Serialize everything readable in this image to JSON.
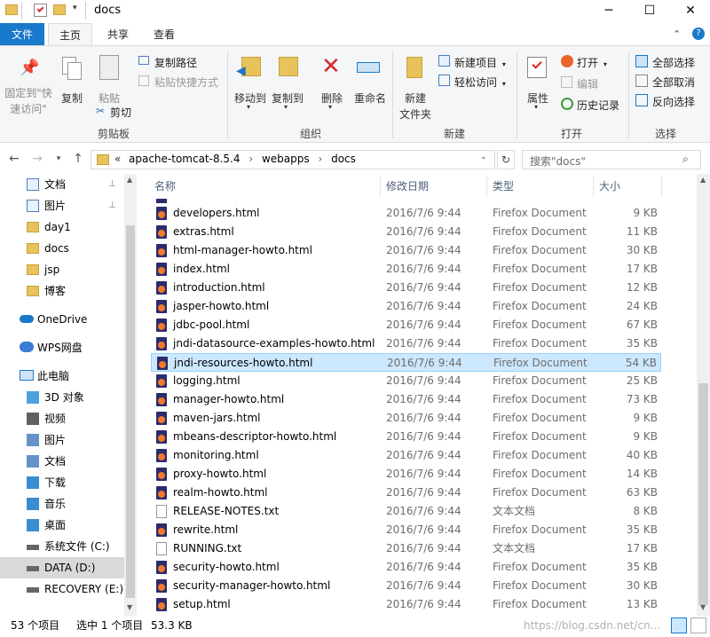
{
  "window": {
    "title": "docs"
  },
  "ribbon_tabs": [
    "文件",
    "主页",
    "共享",
    "查看"
  ],
  "ribbon": {
    "clipboard": {
      "pin_quick_access_line1": "固定到\"快",
      "pin_quick_access_line2": "速访问\"",
      "copy": "复制",
      "paste": "粘贴",
      "copy_path": "复制路径",
      "paste_shortcut": "粘贴快捷方式",
      "cut": "剪切",
      "group": "剪贴板"
    },
    "organize": {
      "move_to": "移动到",
      "copy_to": "复制到",
      "delete": "删除",
      "rename": "重命名",
      "group": "组织"
    },
    "new": {
      "new_folder_line1": "新建",
      "new_folder_line2": "文件夹",
      "new_item": "新建项目",
      "easy_access": "轻松访问",
      "group": "新建"
    },
    "open": {
      "properties": "属性",
      "open": "打开",
      "edit": "编辑",
      "history": "历史记录",
      "group": "打开"
    },
    "select": {
      "select_all": "全部选择",
      "select_none": "全部取消",
      "invert": "反向选择",
      "group": "选择"
    }
  },
  "address": {
    "breadcrumb": [
      "apache-tomcat-8.5.4",
      "webapps",
      "docs"
    ],
    "overflow": "«",
    "search_placeholder": "搜索\"docs\""
  },
  "nav": {
    "quick_access": [
      {
        "label": "文档",
        "icon": "documents-icon",
        "pinned": true
      },
      {
        "label": "图片",
        "icon": "pictures-icon",
        "pinned": true
      },
      {
        "label": "day1",
        "icon": "folder-icon",
        "pinned": false
      },
      {
        "label": "docs",
        "icon": "folder-icon",
        "pinned": false
      },
      {
        "label": "jsp",
        "icon": "folder-icon",
        "pinned": false
      },
      {
        "label": "博客",
        "icon": "folder-icon",
        "pinned": false
      }
    ],
    "onedrive": "OneDrive",
    "wps": "WPS网盘",
    "this_pc": "此电脑",
    "pc_items": [
      {
        "label": "3D 对象",
        "icon": "3d-objects-icon"
      },
      {
        "label": "视频",
        "icon": "videos-icon"
      },
      {
        "label": "图片",
        "icon": "pictures-icon"
      },
      {
        "label": "文档",
        "icon": "documents-icon"
      },
      {
        "label": "下载",
        "icon": "downloads-icon"
      },
      {
        "label": "音乐",
        "icon": "music-icon"
      },
      {
        "label": "桌面",
        "icon": "desktop-icon"
      },
      {
        "label": "系统文件 (C:)",
        "icon": "drive-c-icon"
      },
      {
        "label": "DATA (D:)",
        "icon": "drive-icon"
      },
      {
        "label": "RECOVERY (E:)",
        "icon": "drive-icon"
      }
    ]
  },
  "columns": {
    "name": "名称",
    "date": "修改日期",
    "type": "类型",
    "size": "大小"
  },
  "files": [
    {
      "name": "developers.html",
      "date": "2016/7/6 9:44",
      "type": "Firefox Document",
      "size": "9 KB",
      "kind": "html"
    },
    {
      "name": "extras.html",
      "date": "2016/7/6 9:44",
      "type": "Firefox Document",
      "size": "11 KB",
      "kind": "html"
    },
    {
      "name": "html-manager-howto.html",
      "date": "2016/7/6 9:44",
      "type": "Firefox Document",
      "size": "30 KB",
      "kind": "html"
    },
    {
      "name": "index.html",
      "date": "2016/7/6 9:44",
      "type": "Firefox Document",
      "size": "17 KB",
      "kind": "html"
    },
    {
      "name": "introduction.html",
      "date": "2016/7/6 9:44",
      "type": "Firefox Document",
      "size": "12 KB",
      "kind": "html"
    },
    {
      "name": "jasper-howto.html",
      "date": "2016/7/6 9:44",
      "type": "Firefox Document",
      "size": "24 KB",
      "kind": "html"
    },
    {
      "name": "jdbc-pool.html",
      "date": "2016/7/6 9:44",
      "type": "Firefox Document",
      "size": "67 KB",
      "kind": "html"
    },
    {
      "name": "jndi-datasource-examples-howto.html",
      "date": "2016/7/6 9:44",
      "type": "Firefox Document",
      "size": "35 KB",
      "kind": "html"
    },
    {
      "name": "jndi-resources-howto.html",
      "date": "2016/7/6 9:44",
      "type": "Firefox Document",
      "size": "54 KB",
      "kind": "html",
      "selected": true
    },
    {
      "name": "logging.html",
      "date": "2016/7/6 9:44",
      "type": "Firefox Document",
      "size": "25 KB",
      "kind": "html"
    },
    {
      "name": "manager-howto.html",
      "date": "2016/7/6 9:44",
      "type": "Firefox Document",
      "size": "73 KB",
      "kind": "html"
    },
    {
      "name": "maven-jars.html",
      "date": "2016/7/6 9:44",
      "type": "Firefox Document",
      "size": "9 KB",
      "kind": "html"
    },
    {
      "name": "mbeans-descriptor-howto.html",
      "date": "2016/7/6 9:44",
      "type": "Firefox Document",
      "size": "9 KB",
      "kind": "html"
    },
    {
      "name": "monitoring.html",
      "date": "2016/7/6 9:44",
      "type": "Firefox Document",
      "size": "40 KB",
      "kind": "html"
    },
    {
      "name": "proxy-howto.html",
      "date": "2016/7/6 9:44",
      "type": "Firefox Document",
      "size": "14 KB",
      "kind": "html"
    },
    {
      "name": "realm-howto.html",
      "date": "2016/7/6 9:44",
      "type": "Firefox Document",
      "size": "63 KB",
      "kind": "html"
    },
    {
      "name": "RELEASE-NOTES.txt",
      "date": "2016/7/6 9:44",
      "type": "文本文档",
      "size": "8 KB",
      "kind": "txt"
    },
    {
      "name": "rewrite.html",
      "date": "2016/7/6 9:44",
      "type": "Firefox Document",
      "size": "35 KB",
      "kind": "html"
    },
    {
      "name": "RUNNING.txt",
      "date": "2016/7/6 9:44",
      "type": "文本文档",
      "size": "17 KB",
      "kind": "txt"
    },
    {
      "name": "security-howto.html",
      "date": "2016/7/6 9:44",
      "type": "Firefox Document",
      "size": "35 KB",
      "kind": "html"
    },
    {
      "name": "security-manager-howto.html",
      "date": "2016/7/6 9:44",
      "type": "Firefox Document",
      "size": "30 KB",
      "kind": "html"
    },
    {
      "name": "setup.html",
      "date": "2016/7/6 9:44",
      "type": "Firefox Document",
      "size": "13 KB",
      "kind": "html"
    }
  ],
  "status": {
    "count": "53 个项目",
    "selected": "选中 1 个项目",
    "size": "53.3 KB"
  },
  "watermark": "https://blog.csdn.net/cn...",
  "colors": {
    "accent": "#1979ca",
    "selection": "#cce8ff",
    "selection_border": "#99d1ff"
  }
}
